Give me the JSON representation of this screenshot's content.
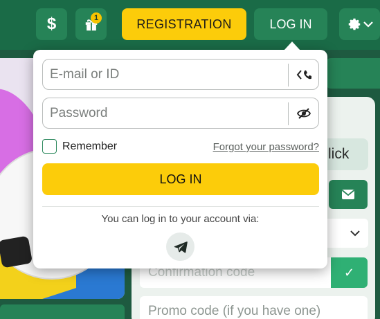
{
  "header": {
    "deposit_icon": "dollar-icon",
    "deposit_glyph": "$",
    "gift_badge_count": "1",
    "registration_label": "REGISTRATION",
    "login_label": "LOG IN",
    "settings_icon": "gear-icon",
    "settings_caret": "▾"
  },
  "login_popup": {
    "email_placeholder": "E-mail or ID",
    "email_toggle_icon": "phone-switch-icon",
    "password_placeholder": "Password",
    "password_toggle_icon": "eye-off-icon",
    "remember_label": "Remember",
    "forgot_label": "Forgot your password?",
    "submit_label": "LOG IN",
    "via_text": "You can log in to your account via:",
    "telegram_icon": "telegram-icon"
  },
  "background_form": {
    "one_click_fragment": "lick",
    "mail_icon": "envelope-icon",
    "select_caret": "⌄",
    "confirmation_placeholder": "Confirmation code",
    "confirm_icon": "check-icon",
    "confirm_glyph": "✓",
    "promo_placeholder": "Promo code (if you have one)"
  },
  "colors": {
    "header_bg": "#1a6b47",
    "accent_yellow": "#fccc0a",
    "brand_green": "#268357"
  }
}
